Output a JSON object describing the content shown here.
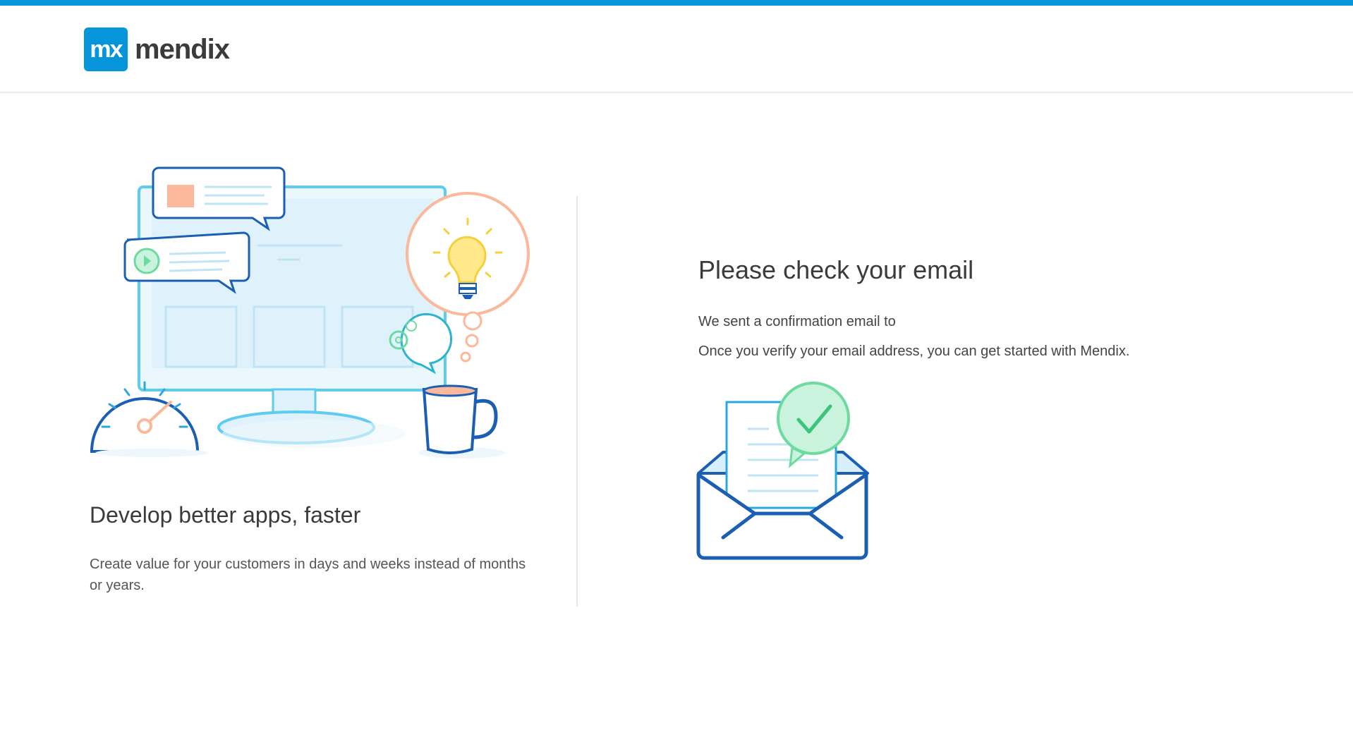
{
  "brand": {
    "logo_mark": "mx",
    "logo_word": "mendix",
    "accent_color": "#0595db"
  },
  "left_panel": {
    "illustration": "developer-workspace-illustration",
    "title": "Develop better apps, faster",
    "description": "Create value for your customers in days and weeks instead of months or years."
  },
  "right_panel": {
    "title": "Please check your email",
    "line1": "We sent a confirmation email to",
    "line2": "Once you verify your email address, you can get started with Mendix.",
    "illustration": "envelope-check-icon"
  }
}
